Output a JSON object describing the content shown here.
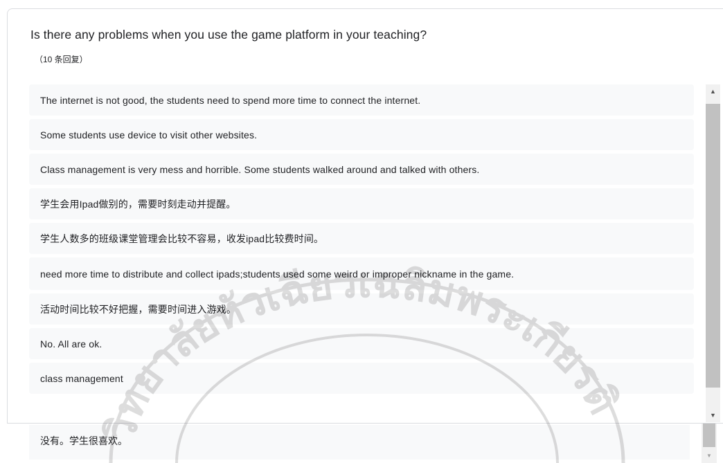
{
  "question": {
    "title": "Is there any problems when you use the game platform in your teaching?",
    "response_count": "（10 条回复）"
  },
  "responses": [
    "The internet is not good, the students need to spend more time to connect the internet.",
    "Some students use device to visit other websites.",
    "Class management is very mess and horrible. Some students walked around and talked with others.",
    "学生会用Ipad做别的，需要时刻走动并提醒。",
    "学生人数多的班级课堂管理会比较不容易，收发ipad比较费时间。",
    "need more time to distribute and collect ipads;students used some weird or improper nickname in the game.",
    "活动时间比较不好把握，需要时间进入游戏。",
    "No. All are ok.",
    "class management",
    "没有。学生很喜欢。"
  ],
  "watermark": {
    "text": "วิทยาลัยหัวเฉียวเฉลิมพระเกียรติ",
    "color": "#000000"
  },
  "icons": {
    "scroll_up": "scroll-up-arrow-icon",
    "scroll_down": "scroll-down-arrow-icon"
  }
}
